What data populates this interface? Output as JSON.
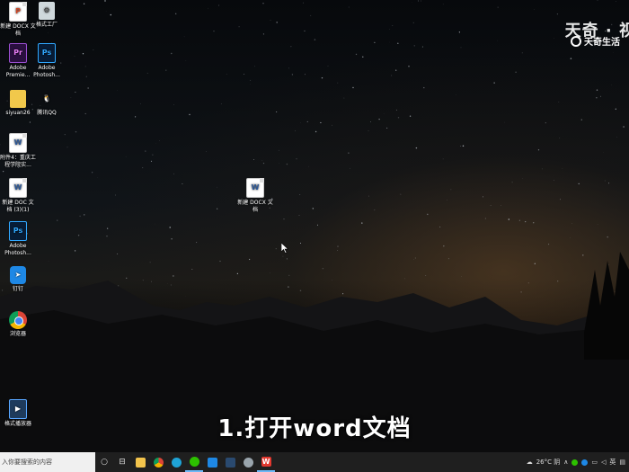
{
  "desktop_icons": [
    {
      "label": "新建 DOCX 文档",
      "kind": "doc-img",
      "glyph": "P"
    },
    {
      "label": "格式工厂",
      "kind": "fac-img",
      "glyph": "⚙"
    },
    {
      "label": "Adobe Premie...",
      "kind": "pr-img",
      "glyph": "Pr"
    },
    {
      "label": "Adobe Photosh...",
      "kind": "ps-img",
      "glyph": "Ps"
    },
    {
      "label": "siyuan26",
      "kind": "file-img",
      "glyph": ""
    },
    {
      "label": "腾讯QQ",
      "kind": "qq-img",
      "glyph": "🐧"
    },
    {
      "label": "附件4：重庆工程学院实...",
      "kind": "doc-img",
      "glyph": "W"
    },
    {
      "label": "新建 DOC 文档 (3)(1)",
      "kind": "doc-img",
      "glyph": "W"
    },
    {
      "label": "Adobe Photosh...",
      "kind": "ps-img",
      "glyph": "Ps"
    },
    {
      "label": "钉钉",
      "kind": "ding-img",
      "glyph": "➤"
    },
    {
      "label": "浏览器",
      "kind": "chrome-img",
      "glyph": ""
    },
    {
      "label": "格式播放器",
      "kind": "player-img",
      "glyph": "▶"
    },
    {
      "label": "新建 DOCX 文档",
      "kind": "doc-img",
      "glyph": "W"
    }
  ],
  "watermark": {
    "line1": "天奇 · 视",
    "line2": "天奇生活"
  },
  "subtitle": "1.打开word文档",
  "taskbar": {
    "search_placeholder": "入你要搜索的内容",
    "weather": "26°C 阴",
    "colors": {
      "bg": "#1f1f1f",
      "accent": "#6cb8f6"
    }
  }
}
